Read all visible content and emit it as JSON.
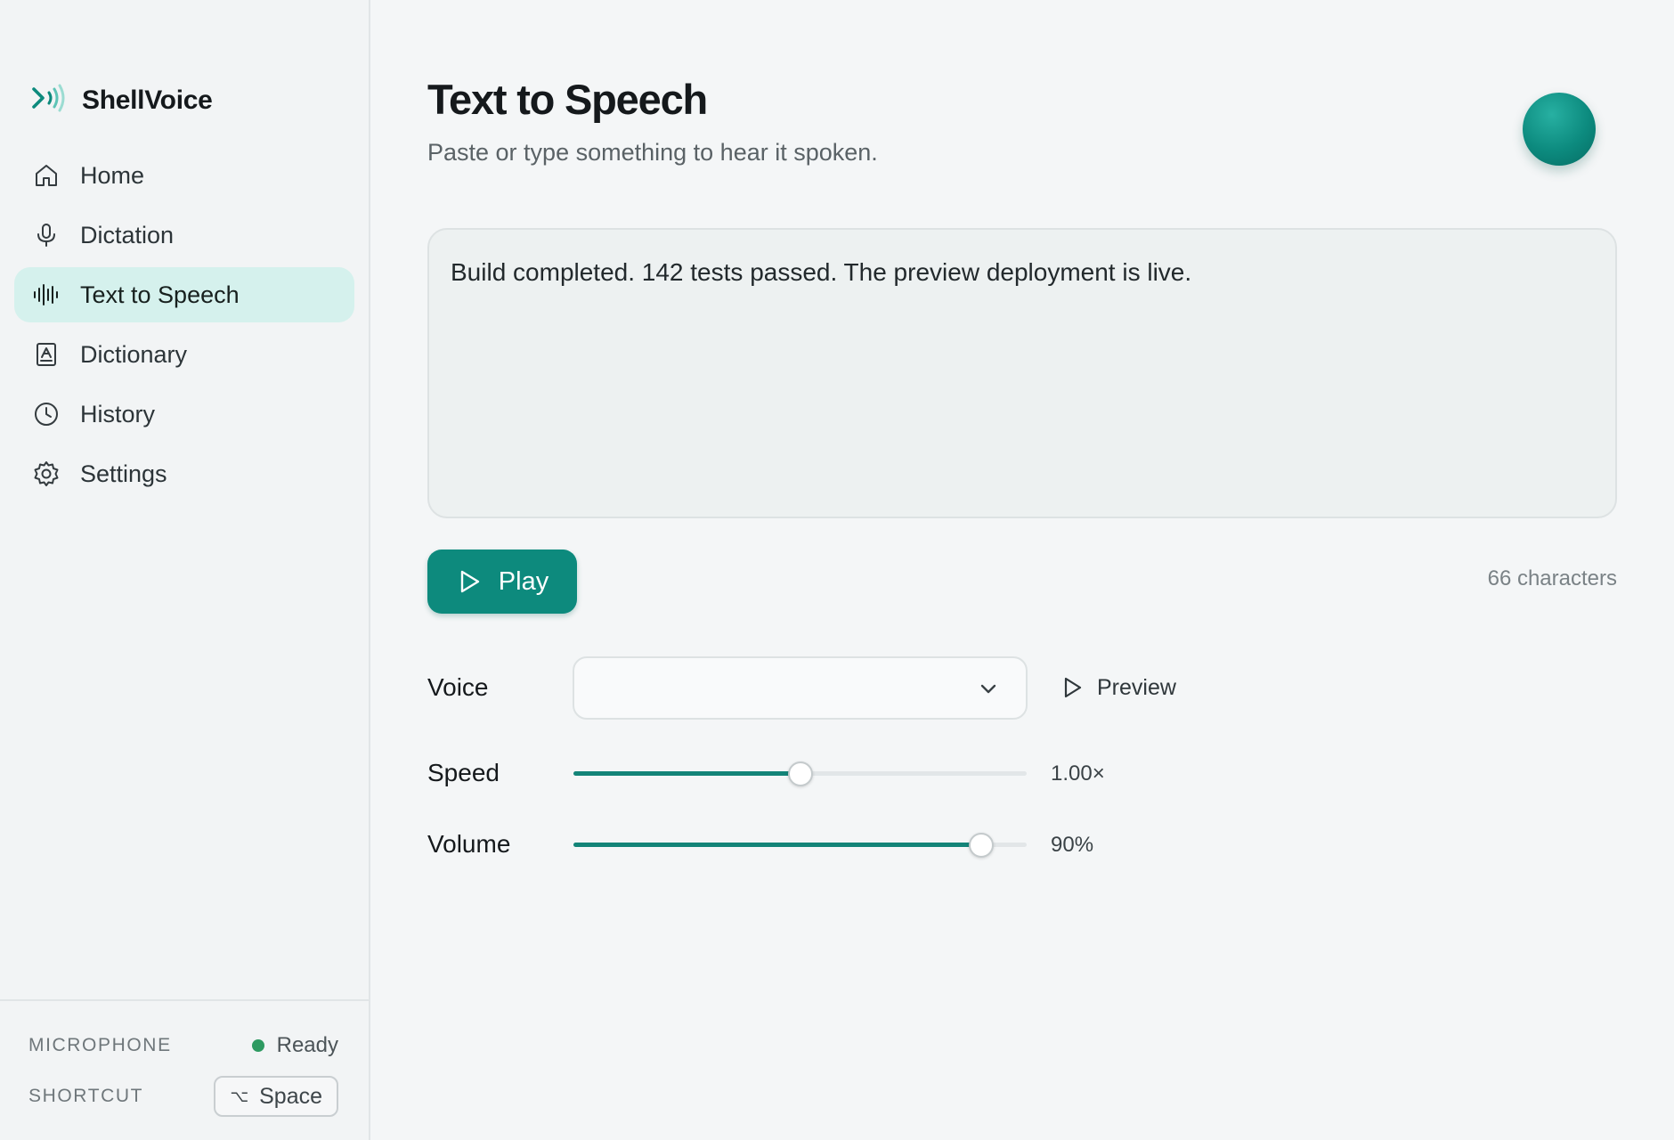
{
  "app": {
    "name": "ShellVoice",
    "accent": "#0d8a7d"
  },
  "sidebar": {
    "items": [
      {
        "label": "Home",
        "icon": "home-icon",
        "active": false
      },
      {
        "label": "Dictation",
        "icon": "microphone-icon",
        "active": false
      },
      {
        "label": "Text to Speech",
        "icon": "waveform-icon",
        "active": true
      },
      {
        "label": "Dictionary",
        "icon": "book-icon",
        "active": false
      },
      {
        "label": "History",
        "icon": "clock-icon",
        "active": false
      },
      {
        "label": "Settings",
        "icon": "gear-icon",
        "active": false
      }
    ],
    "footer": {
      "microphone_label": "MICROPHONE",
      "microphone_status": "Ready",
      "status_color": "#2e9a61",
      "shortcut_label": "SHORTCUT",
      "shortcut_modifier": "⌥",
      "shortcut_key": "Space"
    }
  },
  "main": {
    "title": "Text to Speech",
    "subtitle": "Paste or type something to hear it spoken.",
    "text_input": "Build completed. 142 tests passed. The preview deployment is live.",
    "play_label": "Play",
    "char_count": "66 characters",
    "voice": {
      "label": "Voice",
      "selected": "",
      "preview_label": "Preview"
    },
    "speed": {
      "label": "Speed",
      "value": 0.5,
      "display": "1.00×"
    },
    "volume": {
      "label": "Volume",
      "value": 0.9,
      "display": "90%"
    }
  }
}
